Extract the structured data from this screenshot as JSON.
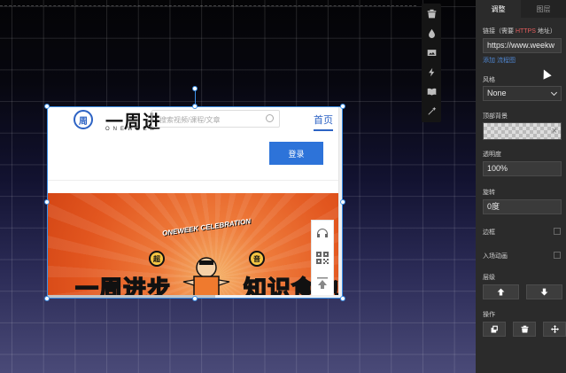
{
  "toolbar": {
    "icons": [
      "trash-icon",
      "drop-icon",
      "image-icon",
      "flash-icon",
      "book-icon",
      "magic-wand-icon"
    ]
  },
  "embed": {
    "logo_char": "周",
    "logo_text": "一周进",
    "logo_sub": "ONEWEEK",
    "search_placeholder": "搜索视频/课程/文章",
    "nav_home": "首页",
    "login_label": "登录",
    "banner_celebration": "ONEWEEK CELEBRATION",
    "badge_left": "超",
    "badge_right": "音",
    "banner_text_left": "一周进步",
    "banner_text_right": "知识食地"
  },
  "panel": {
    "tab_adjust": "调整",
    "tab_layers": "图层",
    "link_label_prefix": "链接（需要 ",
    "link_label_https": "HTTPS",
    "link_label_suffix": " 地址）",
    "link_value": "https://www.weekw",
    "link_help": "添加 流程图",
    "style_label": "风格",
    "style_value": "None",
    "top_bg_label": "顶部背景",
    "opacity_label": "透明度",
    "opacity_value": "100%",
    "rotate_label": "旋转",
    "rotate_value": "0度",
    "border_label": "边框",
    "entry_anim_label": "入场动画",
    "layer_label": "层级",
    "ops_label": "操作"
  }
}
